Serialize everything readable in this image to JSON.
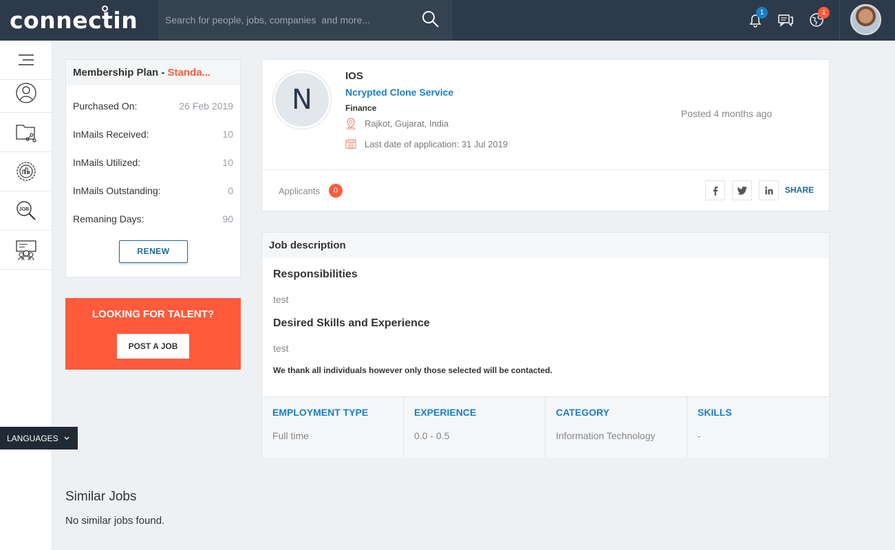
{
  "header": {
    "logo": "connectin",
    "search_placeholder": "Search for people, jobs, companies  and more...",
    "notifications_count": "1",
    "globe_count": "1",
    "icons": [
      "search-icon",
      "bell-icon",
      "chat-icon",
      "globe-icon"
    ]
  },
  "sidebar": {
    "items": [
      "menu-icon",
      "profile-icon",
      "network-icon",
      "company-icon",
      "job-search-icon",
      "groups-icon"
    ],
    "languages_label": "LANGUAGES"
  },
  "membership": {
    "label": "Membership Plan - ",
    "plan": "Standa...",
    "rows": [
      {
        "k": "Purchased On:",
        "v": "26 Feb 2019"
      },
      {
        "k": "InMails Received:",
        "v": "10"
      },
      {
        "k": "InMails Utilized:",
        "v": "10"
      },
      {
        "k": "InMails Outstanding:",
        "v": "0"
      },
      {
        "k": "Remaning Days:",
        "v": "90"
      }
    ],
    "renew_label": "RENEW"
  },
  "talent": {
    "title": "LOOKING FOR TALENT?",
    "button": "POST A JOB"
  },
  "job": {
    "initial": "N",
    "title": "IOS",
    "company": "Ncrypted Clone Service",
    "department": "Finance",
    "location": "Rajkot, Gujarat, India",
    "last_date": "Last date of application: 31 Jul 2019",
    "posted": "Posted 4 months ago",
    "applicants_label": "Applicants",
    "applicants_count": "0",
    "share_label": "SHARE"
  },
  "description": {
    "heading": "Job description",
    "responsibilities_title": "Responsibilities",
    "responsibilities_text": "test",
    "skills_title": "Desired Skills and Experience",
    "skills_text": "test",
    "note": "We thank all individuals however only those selected will be contacted.",
    "details": [
      {
        "h": "EMPLOYMENT TYPE",
        "v": "Full time"
      },
      {
        "h": "EXPERIENCE",
        "v": "0.0 - 0.5"
      },
      {
        "h": "CATEGORY",
        "v": "Information Technology"
      },
      {
        "h": "SKILLS",
        "v": "-"
      }
    ]
  },
  "similar": {
    "title": "Similar Jobs",
    "empty": "No similar jobs found."
  },
  "colors": {
    "topbar": "#2d3a4a",
    "accent": "#ff5a3c",
    "link": "#1a7ec4"
  }
}
